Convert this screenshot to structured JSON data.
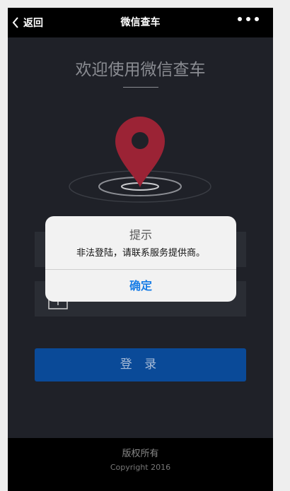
{
  "navbar": {
    "back_label": "返回",
    "title": "微信查车"
  },
  "main": {
    "welcome_text": "欢迎使用微信查车",
    "login_button_label": "登 录"
  },
  "form": {
    "username": {
      "value": "",
      "icon": "envelope-icon"
    },
    "password": {
      "value": "",
      "icon": "lock-icon"
    }
  },
  "dialog": {
    "title": "提示",
    "message": "非法登陆，请联系服务提供商。",
    "confirm_label": "确定"
  },
  "footer": {
    "line1": "版权所有",
    "line2": "Copyright 2016"
  },
  "colors": {
    "background": "#1f2128",
    "pin": "#9b2335",
    "button": "#0a4a98",
    "dialog_action": "#1a7ee6"
  }
}
